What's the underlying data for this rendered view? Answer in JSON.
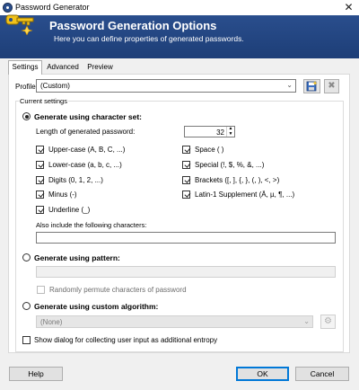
{
  "window": {
    "title": "Password Generator",
    "close_glyph": "✕",
    "app_icon": "keepass-lock-icon"
  },
  "banner": {
    "title": "Password Generation Options",
    "subtitle": "Here you can define properties of generated passwords.",
    "icon": "key-sparkle-icon",
    "color": "#24467f"
  },
  "tabs": [
    {
      "label": "Settings",
      "active": true
    },
    {
      "label": "Advanced",
      "active": false
    },
    {
      "label": "Preview",
      "active": false
    }
  ],
  "profile": {
    "label": "Profile:",
    "value": "(Custom)"
  },
  "current_settings": {
    "group_title": "Current settings",
    "charset_radio": {
      "label": "Generate using character set:",
      "selected": true
    },
    "length": {
      "label": "Length of generated password:",
      "value": "32"
    },
    "options_left": [
      {
        "label": "Upper-case (A, B, C, ...)",
        "checked": true
      },
      {
        "label": "Lower-case (a, b, c, ...)",
        "checked": true
      },
      {
        "label": "Digits (0, 1, 2, ...)",
        "checked": true
      },
      {
        "label": "Minus (-)",
        "checked": true
      },
      {
        "label": "Underline (_)",
        "checked": true
      }
    ],
    "options_right": [
      {
        "label": "Space ( )",
        "checked": true
      },
      {
        "label": "Special (!, $, %, &, ...)",
        "checked": true
      },
      {
        "label": "Brackets ([, ], {, }, (, ), <, >)",
        "checked": true
      },
      {
        "label": "Latin-1 Supplement (Ä, µ, ¶, ...)",
        "checked": true
      }
    ],
    "also_include": {
      "label": "Also include the following characters:",
      "value": ""
    },
    "pattern_radio": {
      "label": "Generate using pattern:",
      "selected": false
    },
    "pattern_value": "",
    "permute": {
      "label": "Randomly permute characters of password",
      "checked": false
    },
    "algorithm_radio": {
      "label": "Generate using custom algorithm:",
      "selected": false
    },
    "algorithm_value": "(None)",
    "entropy": {
      "label": "Show dialog for collecting user input as additional entropy",
      "checked": false
    }
  },
  "buttons": {
    "help": "Help",
    "ok": "OK",
    "cancel": "Cancel"
  }
}
